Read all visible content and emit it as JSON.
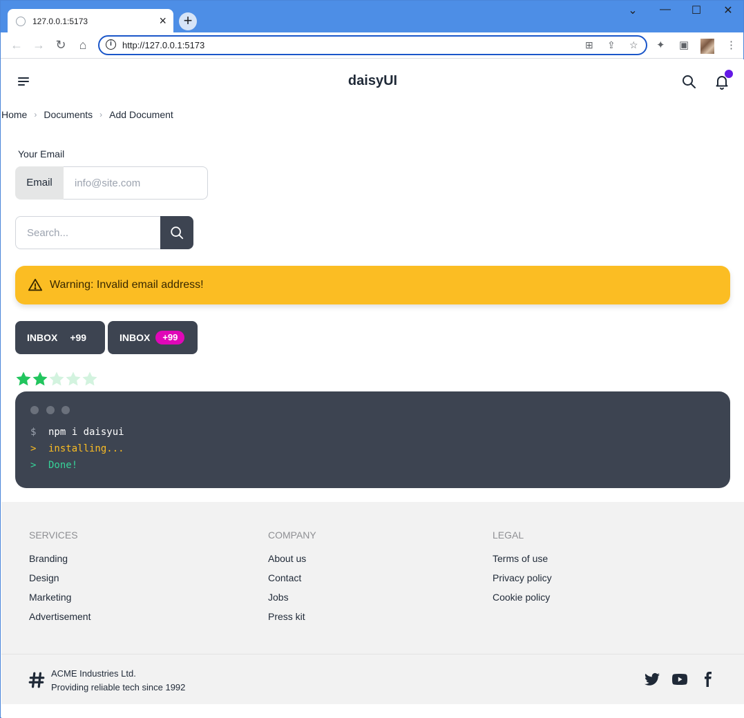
{
  "browser": {
    "tab_title": "127.0.0.1:5173",
    "tab_close": "×",
    "new_tab": "+",
    "url": "http://127.0.0.1:5173",
    "window_controls": [
      "⌄",
      "—",
      "☐",
      "✕"
    ]
  },
  "navbar": {
    "brand": "daisyUI",
    "notification_dot_color": "#6419e6"
  },
  "breadcrumbs": [
    "Home",
    "Documents",
    "Add Document"
  ],
  "email_form": {
    "label": "Your Email",
    "addon": "Email",
    "placeholder": "info@site.com"
  },
  "search": {
    "placeholder": "Search..."
  },
  "alert": {
    "text": "Warning: Invalid email address!",
    "color": "#fbbd23"
  },
  "buttons": [
    {
      "label": "INBOX",
      "badge": "+99"
    },
    {
      "label": "INBOX",
      "badge": "+99",
      "badge_color": "#e007b8"
    }
  ],
  "rating": {
    "value": 2,
    "max": 5,
    "color": "#22c55e"
  },
  "mockup_code": [
    {
      "prefix": "$",
      "text": "npm i daisyui",
      "color": "#ffffff"
    },
    {
      "prefix": ">",
      "text": "installing...",
      "color": "#fbbd23"
    },
    {
      "prefix": ">",
      "text": "Done!",
      "color": "#36d399"
    }
  ],
  "footer": {
    "columns": [
      {
        "title": "SERVICES",
        "links": [
          "Branding",
          "Design",
          "Marketing",
          "Advertisement"
        ]
      },
      {
        "title": "COMPANY",
        "links": [
          "About us",
          "Contact",
          "Jobs",
          "Press kit"
        ]
      },
      {
        "title": "LEGAL",
        "links": [
          "Terms of use",
          "Privacy policy",
          "Cookie policy"
        ]
      }
    ],
    "company_name": "ACME Industries Ltd.",
    "company_tagline": "Providing reliable tech since 1992",
    "social": [
      "twitter-icon",
      "youtube-icon",
      "facebook-icon"
    ]
  }
}
